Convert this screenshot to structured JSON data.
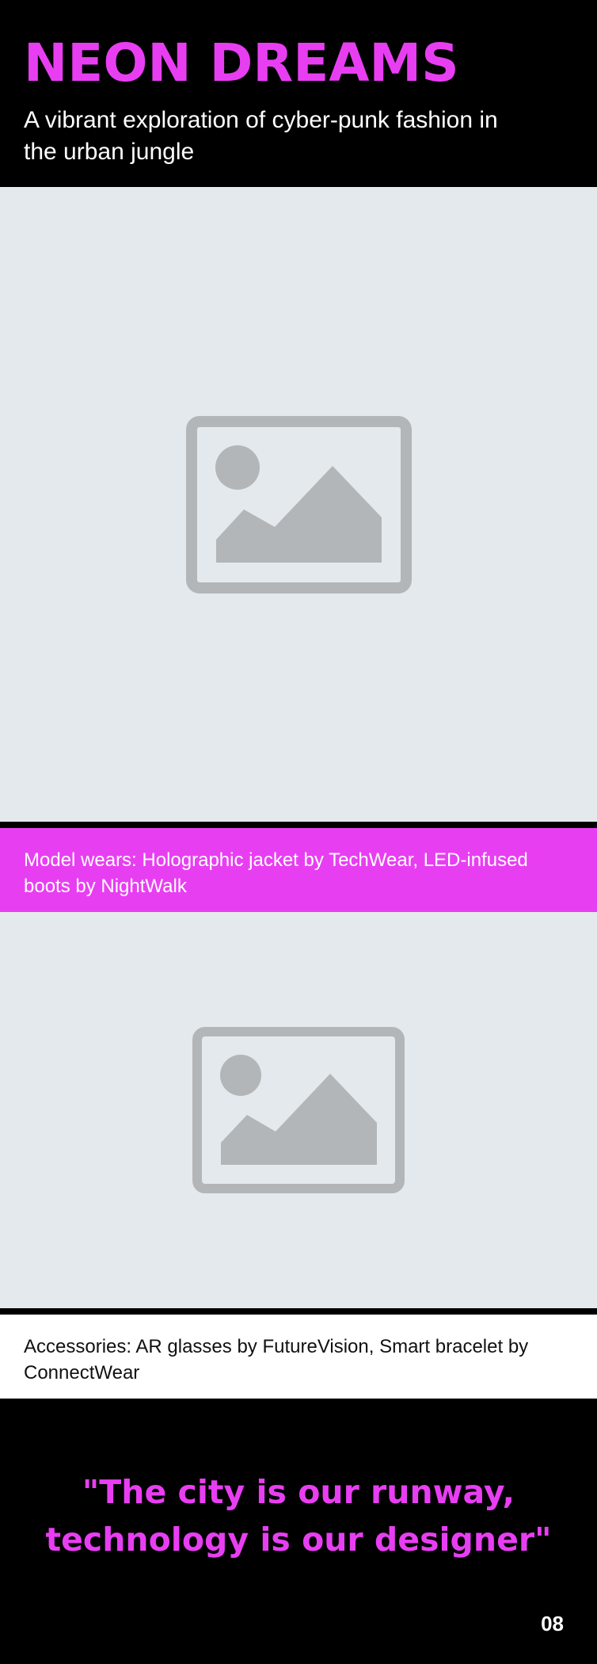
{
  "header": {
    "title": "NEON DREAMS",
    "subtitle": "A vibrant exploration of cyber-punk fashion in the urban jungle"
  },
  "images": [
    {
      "icon": "image-placeholder-icon"
    },
    {
      "icon": "image-placeholder-icon"
    }
  ],
  "captions": {
    "first": "Model wears: Holographic jacket by TechWear, LED-infused boots by NightWalk",
    "second": "Accessories: AR glasses by FutureVision, Smart bracelet by ConnectWear"
  },
  "quote": {
    "text": "\"The city is our runway, technology is our designer\"",
    "page_number": "08"
  },
  "colors": {
    "accent": "#e83ef2",
    "background_dark": "#000000",
    "placeholder_bg": "#e4e9ed",
    "placeholder_icon": "#b3b6b8"
  }
}
